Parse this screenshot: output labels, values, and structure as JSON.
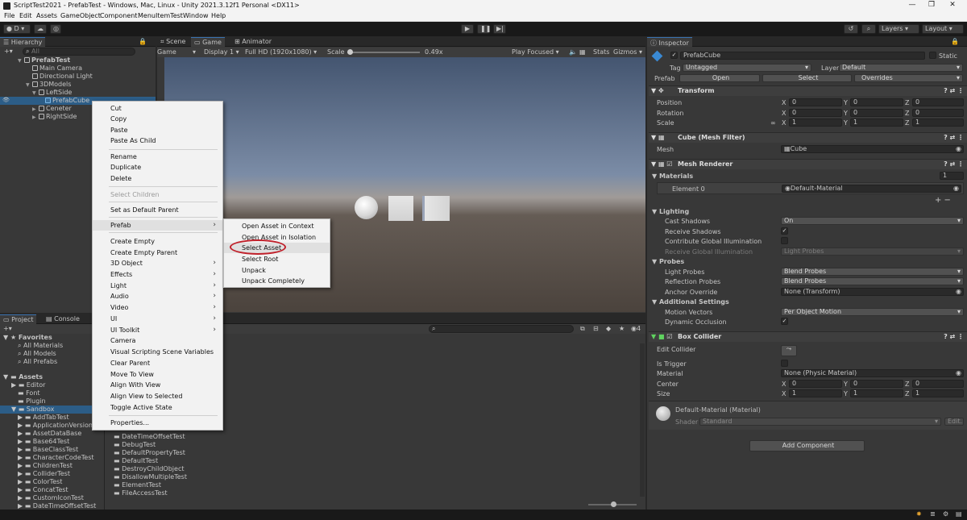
{
  "window": {
    "title": "ScriptTest2021 - PrefabTest - Windows, Mac, Linux - Unity 2021.3.12f1 Personal <DX11>"
  },
  "menubar": [
    "File",
    "Edit",
    "Assets",
    "GameObject",
    "Component",
    "MenuItemTest",
    "Window",
    "Help"
  ],
  "toolbar": {
    "account": "D",
    "layers": "Layers",
    "layout": "Layout"
  },
  "hierarchy": {
    "tab": "Hierarchy",
    "search_placeholder": "All",
    "scene": "PrefabTest",
    "items": [
      "Main Camera",
      "Directional Light",
      "3DModels",
      "LeftSide",
      "PrefabCube",
      "Ceneter",
      "RightSide"
    ]
  },
  "game": {
    "tabs": [
      "Scene",
      "Game",
      "Animator"
    ],
    "display_mode": "Game",
    "display": "Display 1",
    "resolution": "Full HD (1920x1080)",
    "scale_label": "Scale",
    "scale_value": "0.49x",
    "play_mode": "Play Focused",
    "stats": "Stats",
    "gizmos": "Gizmos"
  },
  "project": {
    "tabs": [
      "Project",
      "Console"
    ],
    "favorites": "Favorites",
    "fav_items": [
      "All Materials",
      "All Models",
      "All Prefabs"
    ],
    "assets": "Assets",
    "asset_items": [
      "Editor",
      "Font",
      "Plugin",
      "Sandbox"
    ],
    "sandbox_items": [
      "AddTabTest",
      "ApplicationVersionTe",
      "AssetDataBase",
      "Base64Test",
      "BaseClassTest",
      "CharacterCodeTest",
      "ChildrenTest",
      "ColliderTest",
      "ColorTest",
      "ConcatTest",
      "CustomIconTest",
      "DateTimeOffsetTest"
    ],
    "grid_items": [
      "DateTimeOffsetTest",
      "DebugTest",
      "DefaultPropertyTest",
      "DefaultTest",
      "DestroyChildObject",
      "DisallowMultipleTest",
      "ElementTest",
      "FileAccessTest"
    ],
    "badge": "4"
  },
  "inspector": {
    "tab": "Inspector",
    "object_name": "PrefabCube",
    "static": "Static",
    "tag_label": "Tag",
    "tag": "Untagged",
    "layer_label": "Layer",
    "layer": "Default",
    "prefab_label": "Prefab",
    "open": "Open",
    "select": "Select",
    "overrides": "Overrides",
    "transform": {
      "title": "Transform",
      "rows": [
        {
          "label": "Position",
          "x": "0",
          "y": "0",
          "z": "0"
        },
        {
          "label": "Rotation",
          "x": "0",
          "y": "0",
          "z": "0"
        },
        {
          "label": "Scale",
          "x": "1",
          "y": "1",
          "z": "1"
        }
      ]
    },
    "mesh_filter": {
      "title": "Cube (Mesh Filter)",
      "mesh_label": "Mesh",
      "mesh": "Cube"
    },
    "mesh_renderer": {
      "title": "Mesh Renderer",
      "materials_label": "Materials",
      "materials_count": "1",
      "element0_label": "Element 0",
      "element0": "Default-Material",
      "lighting": "Lighting",
      "cast_shadows_label": "Cast Shadows",
      "cast_shadows": "On",
      "receive_shadows": "Receive Shadows",
      "contribute_gi": "Contribute Global Illumination",
      "receive_gi_label": "Receive Global Illumination",
      "receive_gi": "Light Probes",
      "probes": "Probes",
      "light_probes_label": "Light Probes",
      "light_probes": "Blend Probes",
      "reflection_probes_label": "Reflection Probes",
      "reflection_probes": "Blend Probes",
      "anchor_label": "Anchor Override",
      "anchor": "None (Transform)",
      "additional": "Additional Settings",
      "motion_label": "Motion Vectors",
      "motion": "Per Object Motion",
      "dynamic_occlusion": "Dynamic Occlusion"
    },
    "box_collider": {
      "title": "Box Collider",
      "edit_collider": "Edit Collider",
      "is_trigger": "Is Trigger",
      "material_label": "Material",
      "material": "None (Physic Material)",
      "center_label": "Center",
      "center": {
        "x": "0",
        "y": "0",
        "z": "0"
      },
      "size_label": "Size",
      "size": {
        "x": "1",
        "y": "1",
        "z": "1"
      }
    },
    "material": {
      "title": "Default-Material (Material)",
      "shader_label": "Shader",
      "shader": "Standard",
      "edit": "Edit..."
    },
    "add_component": "Add Component"
  },
  "context_menu": {
    "items": [
      "Cut",
      "Copy",
      "Paste",
      "Paste As Child",
      "Rename",
      "Duplicate",
      "Delete",
      "Select Children",
      "Set as Default Parent",
      "Prefab",
      "Create Empty",
      "Create Empty Parent",
      "3D Object",
      "Effects",
      "Light",
      "Audio",
      "Video",
      "UI",
      "UI Toolkit",
      "Camera",
      "Visual Scripting Scene Variables",
      "Clear Parent",
      "Move To View",
      "Align With View",
      "Align View to Selected",
      "Toggle Active State",
      "Properties..."
    ]
  },
  "prefab_submenu": {
    "items": [
      "Open Asset in Context",
      "Open Asset in Isolation",
      "Select Asset",
      "Select Root",
      "Unpack",
      "Unpack Completely"
    ]
  },
  "colors": {
    "highlight_circle": "#c0202a",
    "selection": "#2c5d87"
  }
}
